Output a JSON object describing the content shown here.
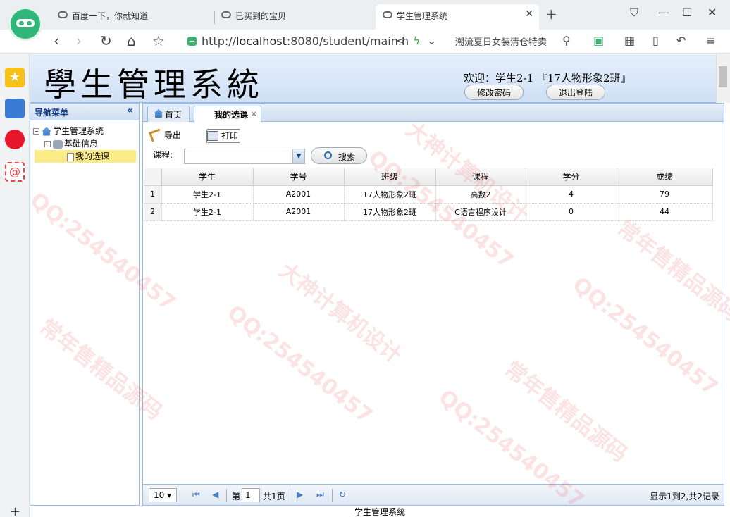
{
  "browser": {
    "tabs": [
      {
        "label": "百度一下，你就知道"
      },
      {
        "label": "已买到的宝贝"
      },
      {
        "label": "学生管理系统"
      }
    ],
    "url": {
      "prefix": "http://",
      "host": "localhost",
      "rest": ":8080/student/main.h"
    },
    "search_text": "潮流夏日女装清仓特卖"
  },
  "header": {
    "title": "學生管理系統",
    "welcome": "欢迎：学生2-1 『17人物形象2班』",
    "change_password_label": "修改密码",
    "logout_label": "退出登陆"
  },
  "nav": {
    "title": "导航菜单",
    "tree": {
      "root": "学生管理系统",
      "group": "基础信息",
      "leaf": "我的选课"
    }
  },
  "main": {
    "tabs": [
      {
        "label": "首页"
      },
      {
        "label": "我的选课"
      }
    ],
    "toolbar": {
      "export_label": "导出",
      "print_label": "打印"
    },
    "filter": {
      "course_label": "课程:",
      "course_value": "",
      "search_label": "搜索"
    },
    "grid": {
      "columns": [
        "学生",
        "学号",
        "班级",
        "课程",
        "学分",
        "成绩"
      ],
      "rows": [
        {
          "no": "1",
          "student": "学生2-1",
          "id": "A2001",
          "class": "17人物形象2班",
          "course": "高数2",
          "credit": "4",
          "score": "79"
        },
        {
          "no": "2",
          "student": "学生2-1",
          "id": "A2001",
          "class": "17人物形象2班",
          "course": "C语言程序设计",
          "credit": "0",
          "score": "44"
        }
      ]
    },
    "pager": {
      "page_size": "10",
      "page_prefix": "第",
      "page_value": "1",
      "page_total": "共1页",
      "info": "显示1到2,共2记录"
    }
  },
  "status_bar": "学生管理系统",
  "watermarks": [
    "QQ:254540457",
    "大神计算机设计",
    "常年售精品源码"
  ]
}
